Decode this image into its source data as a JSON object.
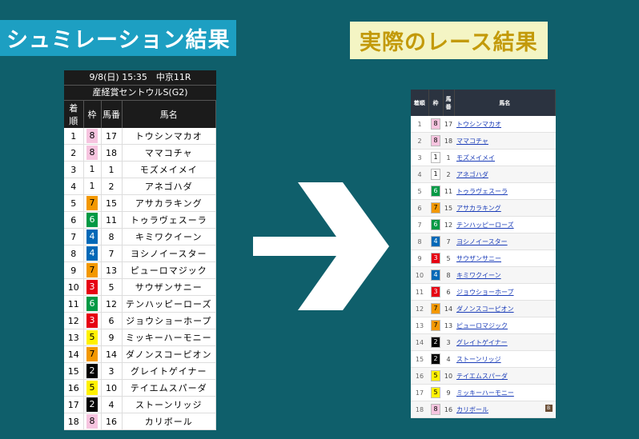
{
  "titles": {
    "simulation": "シュミレーション結果",
    "actual": "実際のレース結果"
  },
  "colors": {
    "background": "#0f5f6b",
    "waku": {
      "1": "#ffffff",
      "2": "#000000",
      "3": "#e60012",
      "4": "#0068b7",
      "5": "#fff100",
      "6": "#009944",
      "7": "#f39800",
      "8": "#f6c4df"
    }
  },
  "simulation": {
    "race_info": "9/8(日) 15:35　中京11R",
    "race_name": "産経賞セントウルS(G2)",
    "columns": [
      "着順",
      "枠",
      "馬番",
      "馬名"
    ],
    "rows": [
      {
        "rank": "1",
        "waku": "8",
        "num": "17",
        "name": "トウシンマカオ"
      },
      {
        "rank": "2",
        "waku": "8",
        "num": "18",
        "name": "ママコチャ"
      },
      {
        "rank": "3",
        "waku": "1",
        "num": "1",
        "name": "モズメイメイ"
      },
      {
        "rank": "4",
        "waku": "1",
        "num": "2",
        "name": "アネゴハダ"
      },
      {
        "rank": "5",
        "waku": "7",
        "num": "15",
        "name": "アサカラキング"
      },
      {
        "rank": "6",
        "waku": "6",
        "num": "11",
        "name": "トゥラヴェスーラ"
      },
      {
        "rank": "7",
        "waku": "4",
        "num": "8",
        "name": "キミワクイーン"
      },
      {
        "rank": "8",
        "waku": "4",
        "num": "7",
        "name": "ヨシノイースター"
      },
      {
        "rank": "9",
        "waku": "7",
        "num": "13",
        "name": "ピューロマジック"
      },
      {
        "rank": "10",
        "waku": "3",
        "num": "5",
        "name": "サウザンサニー"
      },
      {
        "rank": "11",
        "waku": "6",
        "num": "12",
        "name": "テンハッピーローズ"
      },
      {
        "rank": "12",
        "waku": "3",
        "num": "6",
        "name": "ジョウショーホープ"
      },
      {
        "rank": "13",
        "waku": "5",
        "num": "9",
        "name": "ミッキーハーモニー"
      },
      {
        "rank": "14",
        "waku": "7",
        "num": "14",
        "name": "ダノンスコーピオン"
      },
      {
        "rank": "15",
        "waku": "2",
        "num": "3",
        "name": "グレイトゲイナー"
      },
      {
        "rank": "16",
        "waku": "5",
        "num": "10",
        "name": "テイエムスパーダ"
      },
      {
        "rank": "17",
        "waku": "2",
        "num": "4",
        "name": "ストーンリッジ"
      },
      {
        "rank": "18",
        "waku": "8",
        "num": "16",
        "name": "カリボール"
      }
    ]
  },
  "actual": {
    "columns": [
      "着順",
      "枠",
      "馬番",
      "馬名"
    ],
    "rows": [
      {
        "rank": "1",
        "waku": "8",
        "num": "17",
        "name": "トウシンマカオ"
      },
      {
        "rank": "2",
        "waku": "8",
        "num": "18",
        "name": "ママコチャ"
      },
      {
        "rank": "3",
        "waku": "1",
        "num": "1",
        "name": "モズメイメイ"
      },
      {
        "rank": "4",
        "waku": "1",
        "num": "2",
        "name": "アネゴハダ"
      },
      {
        "rank": "5",
        "waku": "6",
        "num": "11",
        "name": "トゥラヴェスーラ"
      },
      {
        "rank": "6",
        "waku": "7",
        "num": "15",
        "name": "アサカラキング"
      },
      {
        "rank": "7",
        "waku": "6",
        "num": "12",
        "name": "テンハッピーローズ"
      },
      {
        "rank": "8",
        "waku": "4",
        "num": "7",
        "name": "ヨシノイースター"
      },
      {
        "rank": "9",
        "waku": "3",
        "num": "5",
        "name": "サウザンサニー"
      },
      {
        "rank": "10",
        "waku": "4",
        "num": "8",
        "name": "キミワクイーン"
      },
      {
        "rank": "11",
        "waku": "3",
        "num": "6",
        "name": "ジョウショーホープ"
      },
      {
        "rank": "12",
        "waku": "7",
        "num": "14",
        "name": "ダノンスコーピオン"
      },
      {
        "rank": "13",
        "waku": "7",
        "num": "13",
        "name": "ピューロマジック"
      },
      {
        "rank": "14",
        "waku": "2",
        "num": "3",
        "name": "グレイトゲイナー"
      },
      {
        "rank": "15",
        "waku": "2",
        "num": "4",
        "name": "ストーンリッジ"
      },
      {
        "rank": "16",
        "waku": "5",
        "num": "10",
        "name": "テイエムスパーダ"
      },
      {
        "rank": "17",
        "waku": "5",
        "num": "9",
        "name": "ミッキーハーモニー"
      },
      {
        "rank": "18",
        "waku": "8",
        "num": "16",
        "name": "カリボール",
        "badge": "B"
      }
    ]
  }
}
